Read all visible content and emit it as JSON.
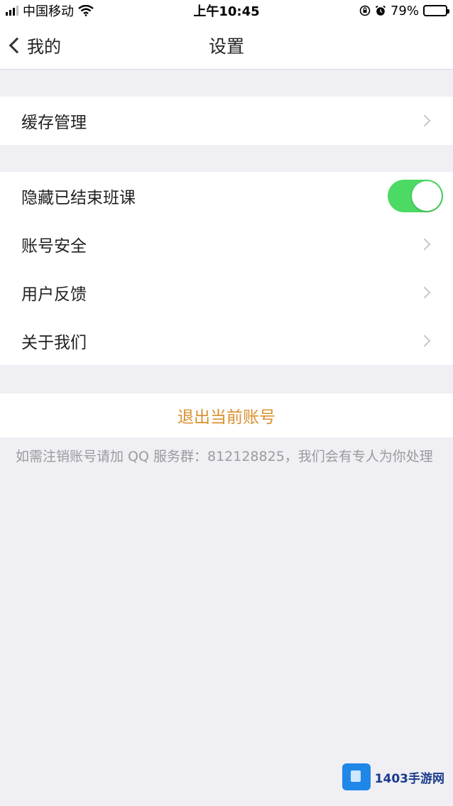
{
  "status_bar": {
    "carrier": "中国移动",
    "time": "上午10:45",
    "battery_percent": "79%",
    "battery_level": 0.79
  },
  "navbar": {
    "back_label": "我的",
    "title": "设置"
  },
  "groups": {
    "cache": {
      "label": "缓存管理"
    },
    "settings": {
      "hide_finished": {
        "label": "隐藏已结束班课",
        "on": true
      },
      "account_security": {
        "label": "账号安全"
      },
      "feedback": {
        "label": "用户反馈"
      },
      "about": {
        "label": "关于我们"
      }
    }
  },
  "logout": {
    "label": "退出当前账号"
  },
  "note": {
    "text": "如需注销账号请加 QQ 服务群：812128825，我们会有专人为你处理"
  },
  "watermark": {
    "text": "1403手游网"
  },
  "colors": {
    "background": "#efeff4",
    "toggle_on": "#4cd964",
    "logout_text": "#d8912f",
    "note_text": "#9a9a9f"
  },
  "icons": {
    "back": "chevron-left-icon",
    "row_arrow": "chevron-right-icon",
    "wifi": "wifi-icon",
    "alarm": "alarm-icon",
    "orientation_lock": "orientation-lock-icon",
    "battery": "battery-icon"
  }
}
